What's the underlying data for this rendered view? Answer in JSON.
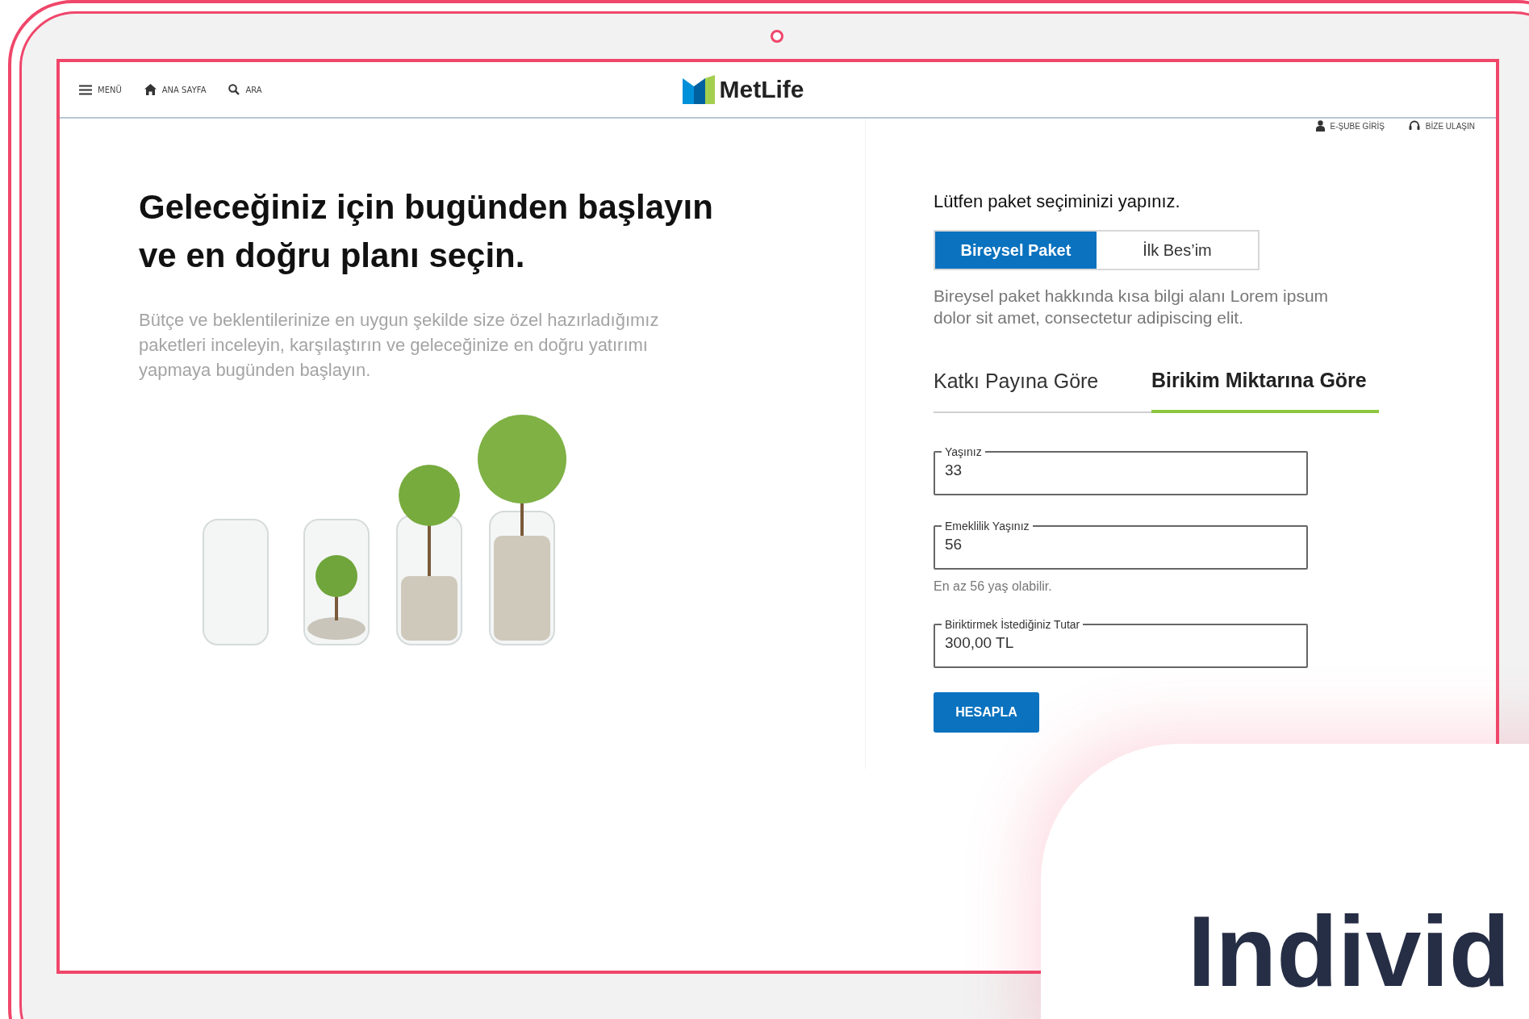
{
  "header": {
    "left_items": [
      {
        "kind": "menu",
        "label": "MENÜ"
      },
      {
        "kind": "home",
        "label": "ANA SAYFA"
      },
      {
        "kind": "search",
        "label": "ARA"
      }
    ],
    "logo": "MetLife",
    "right_items": [
      {
        "kind": "user",
        "label": "E-ŞUBE GİRİŞ"
      },
      {
        "kind": "headset",
        "label": "BİZE ULAŞIN"
      }
    ]
  },
  "hero": {
    "title": "Geleceğiniz için bugünden başlayın ve en doğru planı seçin.",
    "description": "Bütçe ve beklentilerinize en uygun şekilde size özel hazırladığımız paketleri inceleyin, karşılaştırın ve geleceğinize en doğru yatırımı yapmaya bugünden başlayın."
  },
  "form": {
    "heading": "Lütfen paket seçiminizi yapınız.",
    "packages": [
      {
        "label": "Bireysel Paket",
        "selected": true
      },
      {
        "label": "İlk Bes’im",
        "selected": false
      }
    ],
    "package_info": "Bireysel paket hakkında kısa bilgi alanı Lorem ipsum dolor sit amet, consectetur adipiscing elit.",
    "calc_tabs": [
      {
        "label": "Katkı Payına Göre",
        "selected": false
      },
      {
        "label": "Birikim Miktarına Göre",
        "selected": true
      }
    ],
    "fields": [
      {
        "label": "Yaşınız",
        "value": "33"
      },
      {
        "label": "Emeklilik Yaşınız",
        "value": "56",
        "hint": "En az 56 yaş olabilir."
      },
      {
        "label": "Biriktirmek İstediğiniz Tutar",
        "value": "300,00 TL"
      }
    ],
    "submit": "HESAPLA"
  },
  "overlay_card": {
    "text": "Individ"
  }
}
